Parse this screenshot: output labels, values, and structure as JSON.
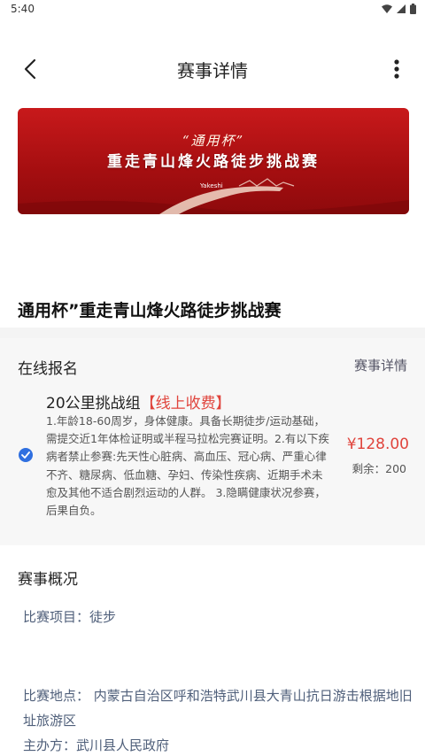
{
  "status_bar": {
    "time": "5:40"
  },
  "header": {
    "title": "赛事详情"
  },
  "banner": {
    "subtitle": "“通用杯”",
    "headline": "重走青山烽火路徒步挑战赛",
    "logo_text": "Yakeshi"
  },
  "event": {
    "title": "通用杯”重走青山烽火路徒步挑战赛"
  },
  "registration": {
    "heading": "在线报名",
    "details_link": "赛事详情",
    "option": {
      "name": "20公里挑战组",
      "tag": "【线上收费】",
      "description": "1.年龄18-60周岁，身体健康。具备长期徒步/运动基础，需提交近1年体检证明或半程马拉松完赛证明。2.有以下疾病者禁止参赛:先天性心脏病、高血压、冠心病、严重心律不齐、糖尿病、低血糖、孕妇、传染性疾病、近期手术未愈及其他不适合剧烈运动的人群。 3.隐瞒健康状况参赛，后果自负。",
      "price": "¥128.00",
      "remaining": "剩余：200",
      "selected": true
    }
  },
  "overview": {
    "heading": "赛事概况",
    "item": "比赛项目：徒步",
    "location": "比赛地点： 内蒙古自治区呼和浩特武川县大青山抗日游击根据地旧址旅游区",
    "host": "主办方：武川县人民政府"
  },
  "colors": {
    "accent_red": "#e0443c",
    "check_blue": "#2f6fe0",
    "banner_red": "#c8191b"
  }
}
